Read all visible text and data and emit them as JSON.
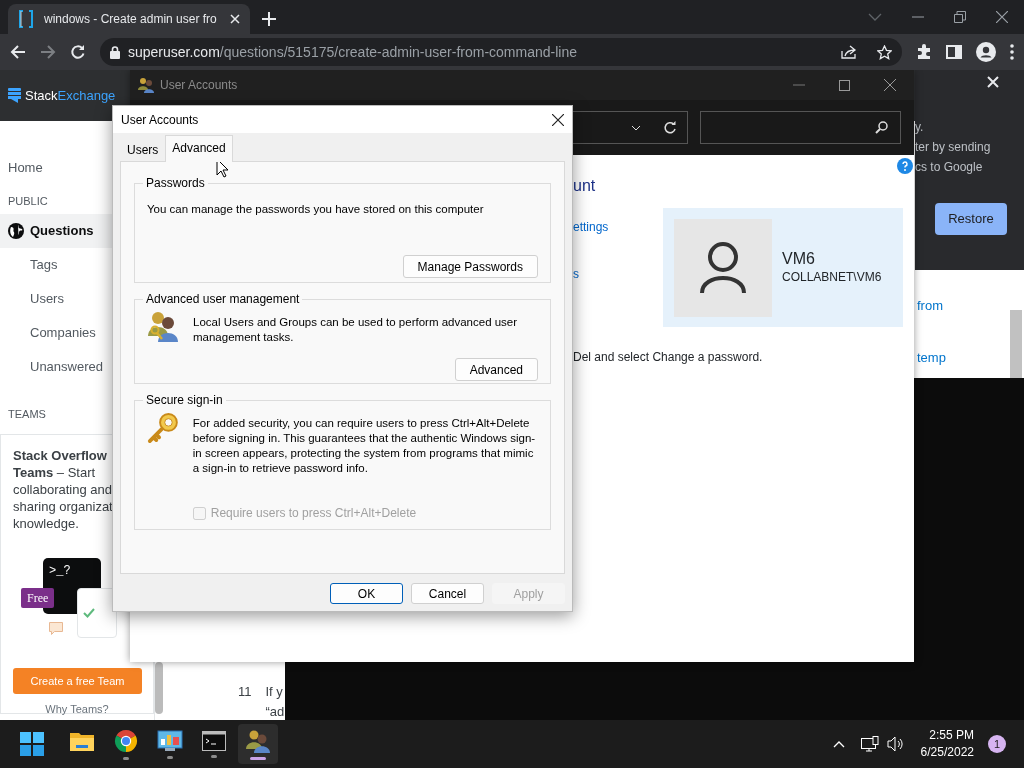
{
  "browser": {
    "tab_title": "windows - Create admin user fro",
    "url_host": "superuser.com",
    "url_path": "/questions/515175/create-admin-user-from-command-line"
  },
  "site": {
    "logo_first": "Stack",
    "logo_second": "Exchange",
    "home": {
      "label": "Home",
      "selected": false
    },
    "public_heading": "PUBLIC",
    "public_items": [
      {
        "label": "Questions",
        "kind": "main",
        "selected": true
      },
      {
        "label": "Tags",
        "kind": "sub",
        "selected": false
      },
      {
        "label": "Users",
        "kind": "sub",
        "selected": false
      },
      {
        "label": "Companies",
        "kind": "sub",
        "selected": false
      },
      {
        "label": "Unanswered",
        "kind": "sub",
        "selected": false
      }
    ],
    "teams_heading": "TEAMS",
    "promo": {
      "lines": [
        "**Stack Overflow**",
        "**Teams** – Start",
        "collaborating and",
        "sharing organizat",
        "knowledge."
      ],
      "prompt": ">_?",
      "badge": "Free",
      "button": "Create a free Team",
      "link": "Why Teams?"
    },
    "answer": {
      "votes": "11",
      "lines": [
        "If y",
        "“ad"
      ]
    },
    "right_links": [
      "from",
      "temp"
    ]
  },
  "sync_popup": {
    "lines": [
      "y.",
      "ter by sending",
      "cs to Google"
    ],
    "button": "Restore"
  },
  "control_panel": {
    "title": "User Accounts",
    "heading": "unt",
    "links": [
      "ettings",
      "s"
    ],
    "user": {
      "name": "VM6",
      "account": "COLLABNET\\VM6"
    },
    "note": "Del and select Change a password."
  },
  "dialog": {
    "title": "User Accounts",
    "tabs": [
      {
        "label": "Users",
        "selected": false
      },
      {
        "label": "Advanced",
        "selected": true
      }
    ],
    "groups": [
      {
        "kind": "passwords",
        "legend": "Passwords",
        "text": "You can manage the passwords you have stored on this computer",
        "button": "Manage Passwords"
      },
      {
        "kind": "management",
        "legend": "Advanced user management",
        "text": "Local Users and Groups can be used to perform advanced user management tasks.",
        "button": "Advanced"
      },
      {
        "kind": "signin",
        "legend": "Secure sign-in",
        "text": "For added security, you can require users to press Ctrl+Alt+Delete before signing in. This guarantees that the authentic Windows sign-in screen appears, protecting the system from programs that mimic a sign-in to retrieve password info.",
        "checkbox": {
          "label": "Require users to press Ctrl+Alt+Delete",
          "checked": false,
          "disabled": true
        }
      }
    ],
    "buttons": [
      {
        "label": "OK",
        "default": true,
        "disabled": false
      },
      {
        "label": "Cancel",
        "default": false,
        "disabled": false
      },
      {
        "label": "Apply",
        "default": false,
        "disabled": true
      }
    ]
  },
  "taskbar": {
    "apps": [
      {
        "kind": "explorer",
        "running": false,
        "selected": false
      },
      {
        "kind": "chrome",
        "running": true,
        "selected": false
      },
      {
        "kind": "control-panel",
        "running": true,
        "selected": false
      },
      {
        "kind": "terminal",
        "running": true,
        "selected": false
      },
      {
        "kind": "user-accounts",
        "running": true,
        "selected": true
      }
    ],
    "time": "2:55 PM",
    "date": "6/25/2022",
    "notifications": "1"
  }
}
